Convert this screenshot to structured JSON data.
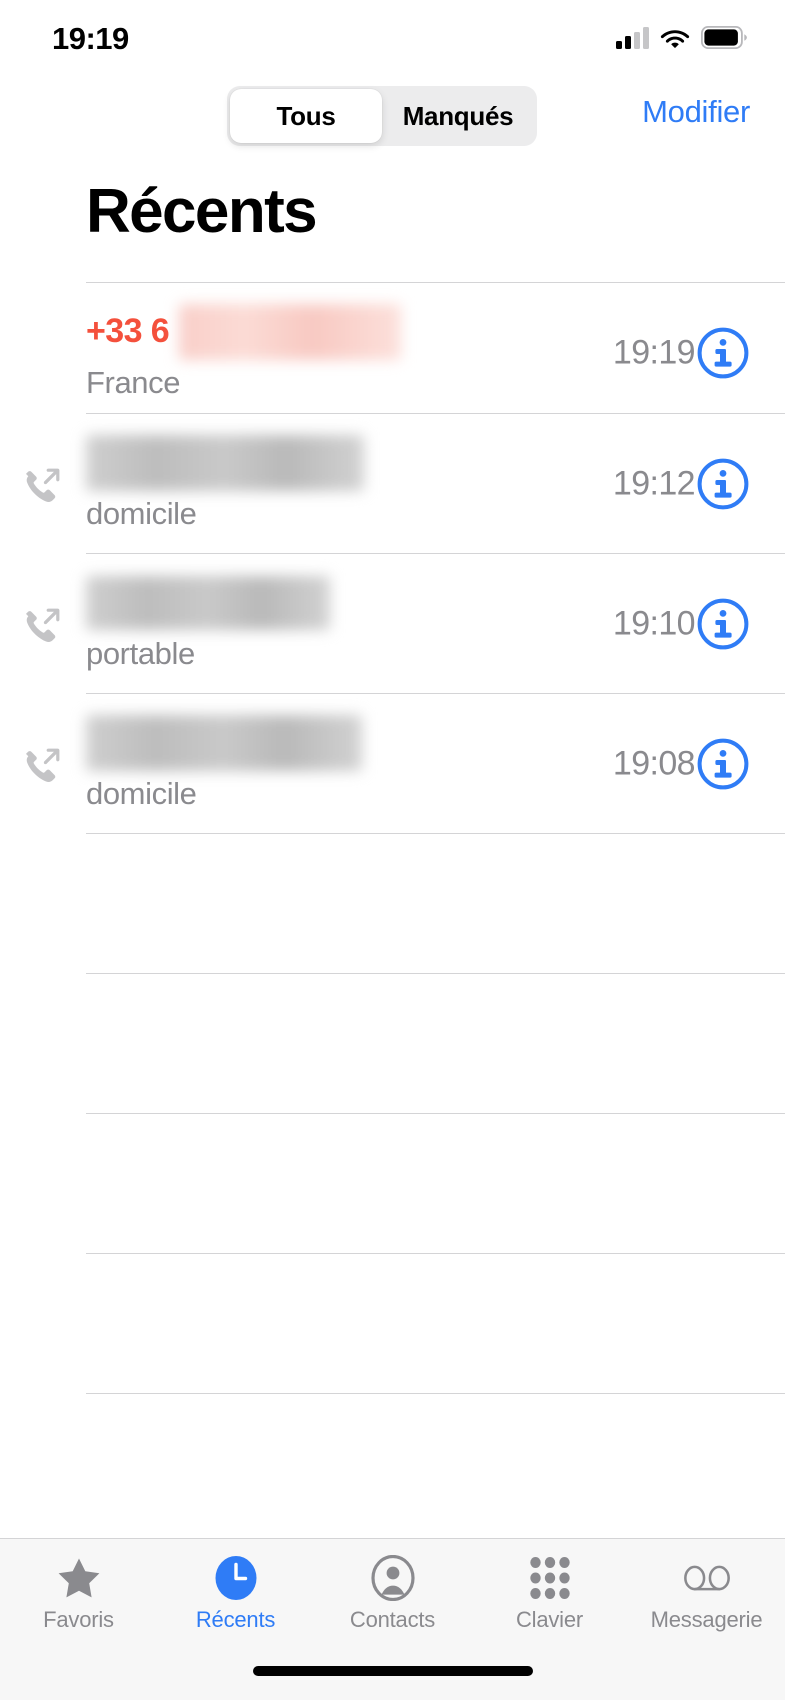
{
  "status_bar": {
    "time": "19:19",
    "signal_icon": "cellular-signal-icon",
    "signal_bars_filled": 2,
    "signal_bars_total": 4,
    "wifi_icon": "wifi-icon",
    "battery_icon": "battery-icon",
    "battery_level_pct": 90
  },
  "nav": {
    "segments": [
      {
        "label": "Tous",
        "selected": true
      },
      {
        "label": "Manqués",
        "selected": false
      }
    ],
    "edit_label": "Modifier"
  },
  "page": {
    "title": "Récents"
  },
  "calls": [
    {
      "direction_icon": null,
      "title": "+33 6",
      "title_redacted": true,
      "title_color": "#f4503c",
      "subtitle": "France",
      "time": "19:19",
      "info_icon": "info-circle-icon"
    },
    {
      "direction_icon": "outgoing-call-icon",
      "title": "",
      "title_redacted": true,
      "title_color": "#000000",
      "subtitle": "domicile",
      "time": "19:12",
      "info_icon": "info-circle-icon"
    },
    {
      "direction_icon": "outgoing-call-icon",
      "title": "",
      "title_redacted": true,
      "title_color": "#000000",
      "subtitle": "portable",
      "time": "19:10",
      "info_icon": "info-circle-icon"
    },
    {
      "direction_icon": "outgoing-call-icon",
      "title": "",
      "title_redacted": true,
      "title_color": "#000000",
      "subtitle": "domicile",
      "time": "19:08",
      "info_icon": "info-circle-icon"
    }
  ],
  "tabs": [
    {
      "label": "Favoris",
      "icon": "star-icon",
      "active": false
    },
    {
      "label": "Récents",
      "icon": "clock-icon",
      "active": true
    },
    {
      "label": "Contacts",
      "icon": "person-icon",
      "active": false
    },
    {
      "label": "Clavier",
      "icon": "keypad-icon",
      "active": false
    },
    {
      "label": "Messagerie",
      "icon": "voicemail-icon",
      "active": false
    }
  ],
  "colors": {
    "accent_blue": "#2f7cf6",
    "missed_red": "#f4503c",
    "secondary_gray": "#8a8a8e",
    "divider": "#d4d4d6",
    "tabbar_bg": "#f7f7f7"
  }
}
